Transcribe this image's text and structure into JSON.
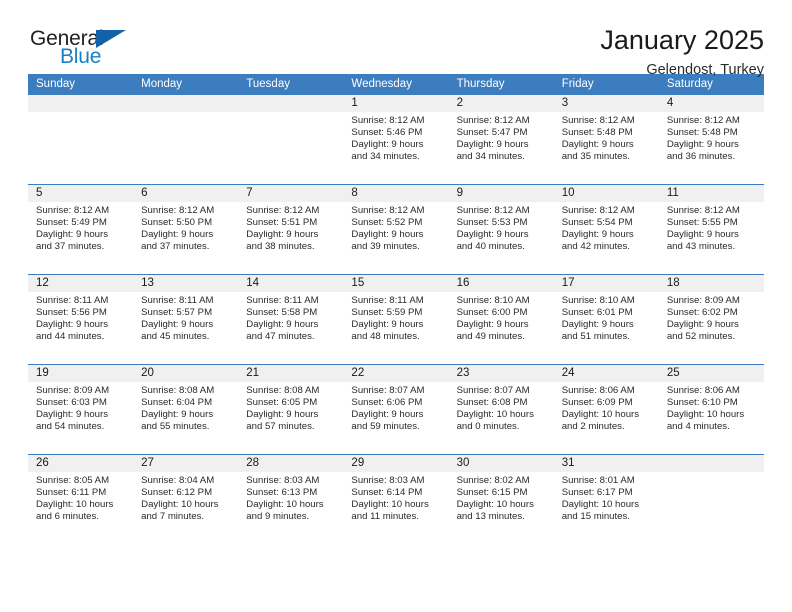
{
  "brand": {
    "name_part1": "General",
    "name_part2": "Blue",
    "triangle_color": "#1362a8",
    "blue": "#1b7fc4"
  },
  "header": {
    "title": "January 2025",
    "subtitle": "Gelendost, Turkey"
  },
  "theme": {
    "header_bg": "#3c7dbf",
    "header_text": "#ffffff",
    "daynum_bg": "#f0f0f0",
    "cell_bg": "#ffffff",
    "separator": "#3c7dbf"
  },
  "weekdays": [
    "Sunday",
    "Monday",
    "Tuesday",
    "Wednesday",
    "Thursday",
    "Friday",
    "Saturday"
  ],
  "weeks": [
    [
      {
        "day": "",
        "lines": []
      },
      {
        "day": "",
        "lines": []
      },
      {
        "day": "",
        "lines": []
      },
      {
        "day": "1",
        "lines": [
          "Sunrise: 8:12 AM",
          "Sunset: 5:46 PM",
          "Daylight: 9 hours",
          "and 34 minutes."
        ]
      },
      {
        "day": "2",
        "lines": [
          "Sunrise: 8:12 AM",
          "Sunset: 5:47 PM",
          "Daylight: 9 hours",
          "and 34 minutes."
        ]
      },
      {
        "day": "3",
        "lines": [
          "Sunrise: 8:12 AM",
          "Sunset: 5:48 PM",
          "Daylight: 9 hours",
          "and 35 minutes."
        ]
      },
      {
        "day": "4",
        "lines": [
          "Sunrise: 8:12 AM",
          "Sunset: 5:48 PM",
          "Daylight: 9 hours",
          "and 36 minutes."
        ]
      }
    ],
    [
      {
        "day": "5",
        "lines": [
          "Sunrise: 8:12 AM",
          "Sunset: 5:49 PM",
          "Daylight: 9 hours",
          "and 37 minutes."
        ]
      },
      {
        "day": "6",
        "lines": [
          "Sunrise: 8:12 AM",
          "Sunset: 5:50 PM",
          "Daylight: 9 hours",
          "and 37 minutes."
        ]
      },
      {
        "day": "7",
        "lines": [
          "Sunrise: 8:12 AM",
          "Sunset: 5:51 PM",
          "Daylight: 9 hours",
          "and 38 minutes."
        ]
      },
      {
        "day": "8",
        "lines": [
          "Sunrise: 8:12 AM",
          "Sunset: 5:52 PM",
          "Daylight: 9 hours",
          "and 39 minutes."
        ]
      },
      {
        "day": "9",
        "lines": [
          "Sunrise: 8:12 AM",
          "Sunset: 5:53 PM",
          "Daylight: 9 hours",
          "and 40 minutes."
        ]
      },
      {
        "day": "10",
        "lines": [
          "Sunrise: 8:12 AM",
          "Sunset: 5:54 PM",
          "Daylight: 9 hours",
          "and 42 minutes."
        ]
      },
      {
        "day": "11",
        "lines": [
          "Sunrise: 8:12 AM",
          "Sunset: 5:55 PM",
          "Daylight: 9 hours",
          "and 43 minutes."
        ]
      }
    ],
    [
      {
        "day": "12",
        "lines": [
          "Sunrise: 8:11 AM",
          "Sunset: 5:56 PM",
          "Daylight: 9 hours",
          "and 44 minutes."
        ]
      },
      {
        "day": "13",
        "lines": [
          "Sunrise: 8:11 AM",
          "Sunset: 5:57 PM",
          "Daylight: 9 hours",
          "and 45 minutes."
        ]
      },
      {
        "day": "14",
        "lines": [
          "Sunrise: 8:11 AM",
          "Sunset: 5:58 PM",
          "Daylight: 9 hours",
          "and 47 minutes."
        ]
      },
      {
        "day": "15",
        "lines": [
          "Sunrise: 8:11 AM",
          "Sunset: 5:59 PM",
          "Daylight: 9 hours",
          "and 48 minutes."
        ]
      },
      {
        "day": "16",
        "lines": [
          "Sunrise: 8:10 AM",
          "Sunset: 6:00 PM",
          "Daylight: 9 hours",
          "and 49 minutes."
        ]
      },
      {
        "day": "17",
        "lines": [
          "Sunrise: 8:10 AM",
          "Sunset: 6:01 PM",
          "Daylight: 9 hours",
          "and 51 minutes."
        ]
      },
      {
        "day": "18",
        "lines": [
          "Sunrise: 8:09 AM",
          "Sunset: 6:02 PM",
          "Daylight: 9 hours",
          "and 52 minutes."
        ]
      }
    ],
    [
      {
        "day": "19",
        "lines": [
          "Sunrise: 8:09 AM",
          "Sunset: 6:03 PM",
          "Daylight: 9 hours",
          "and 54 minutes."
        ]
      },
      {
        "day": "20",
        "lines": [
          "Sunrise: 8:08 AM",
          "Sunset: 6:04 PM",
          "Daylight: 9 hours",
          "and 55 minutes."
        ]
      },
      {
        "day": "21",
        "lines": [
          "Sunrise: 8:08 AM",
          "Sunset: 6:05 PM",
          "Daylight: 9 hours",
          "and 57 minutes."
        ]
      },
      {
        "day": "22",
        "lines": [
          "Sunrise: 8:07 AM",
          "Sunset: 6:06 PM",
          "Daylight: 9 hours",
          "and 59 minutes."
        ]
      },
      {
        "day": "23",
        "lines": [
          "Sunrise: 8:07 AM",
          "Sunset: 6:08 PM",
          "Daylight: 10 hours",
          "and 0 minutes."
        ]
      },
      {
        "day": "24",
        "lines": [
          "Sunrise: 8:06 AM",
          "Sunset: 6:09 PM",
          "Daylight: 10 hours",
          "and 2 minutes."
        ]
      },
      {
        "day": "25",
        "lines": [
          "Sunrise: 8:06 AM",
          "Sunset: 6:10 PM",
          "Daylight: 10 hours",
          "and 4 minutes."
        ]
      }
    ],
    [
      {
        "day": "26",
        "lines": [
          "Sunrise: 8:05 AM",
          "Sunset: 6:11 PM",
          "Daylight: 10 hours",
          "and 6 minutes."
        ]
      },
      {
        "day": "27",
        "lines": [
          "Sunrise: 8:04 AM",
          "Sunset: 6:12 PM",
          "Daylight: 10 hours",
          "and 7 minutes."
        ]
      },
      {
        "day": "28",
        "lines": [
          "Sunrise: 8:03 AM",
          "Sunset: 6:13 PM",
          "Daylight: 10 hours",
          "and 9 minutes."
        ]
      },
      {
        "day": "29",
        "lines": [
          "Sunrise: 8:03 AM",
          "Sunset: 6:14 PM",
          "Daylight: 10 hours",
          "and 11 minutes."
        ]
      },
      {
        "day": "30",
        "lines": [
          "Sunrise: 8:02 AM",
          "Sunset: 6:15 PM",
          "Daylight: 10 hours",
          "and 13 minutes."
        ]
      },
      {
        "day": "31",
        "lines": [
          "Sunrise: 8:01 AM",
          "Sunset: 6:17 PM",
          "Daylight: 10 hours",
          "and 15 minutes."
        ]
      },
      {
        "day": "",
        "lines": []
      }
    ]
  ]
}
